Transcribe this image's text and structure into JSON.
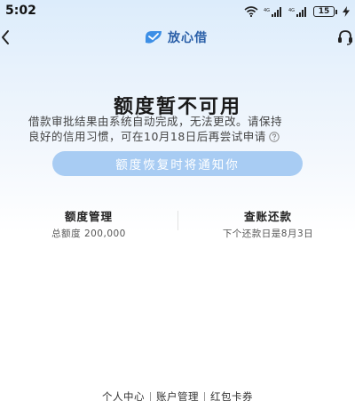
{
  "status_bar": {
    "time": "5:02",
    "battery_level": "15",
    "icons": [
      "wifi-icon",
      "signal-icon",
      "signal-icon",
      "battery-icon",
      "charging-bolt-icon"
    ]
  },
  "header": {
    "brand_name": "放心借",
    "back_icon": "back-chevron-icon",
    "service_icon": "headset-icon",
    "brand_logo": "brand-logo-icon"
  },
  "main": {
    "title": "额度暂不可用",
    "description_line1": "借款审批结果由系统自动完成，无法更改。请保持",
    "description_line2": "良好的信用习惯，可在10月18日后再尝试申请",
    "notify_button_label": "额度恢复时将通知你"
  },
  "entries": [
    {
      "title": "额度管理",
      "subtitle": "总额度 200,000"
    },
    {
      "title": "查账还款",
      "subtitle": "下个还款日是8月3日"
    }
  ],
  "bottom_links": [
    "个人中心",
    "账户管理",
    "红包卡券"
  ],
  "colors": {
    "accent": "#2a5fa8",
    "button_bg": "#a8ccf3",
    "bg_top": "#dcecfb"
  }
}
